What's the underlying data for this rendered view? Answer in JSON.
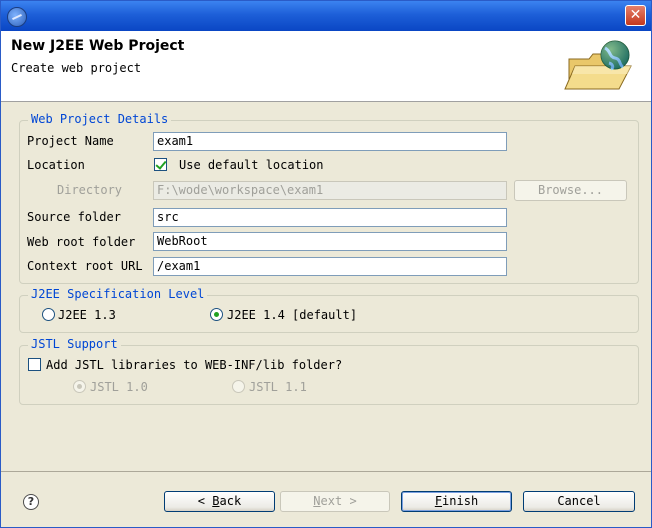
{
  "window": {
    "close_glyph": "✕"
  },
  "header": {
    "title": "New J2EE Web Project",
    "subtitle": "Create web project"
  },
  "web_details": {
    "group_title": "Web Project Details",
    "project_name_label": "Project Name",
    "project_name_value": "exam1",
    "location_label": "Location",
    "use_default_label": "Use default location",
    "use_default_checked": true,
    "directory_label": "Directory",
    "directory_value": "F:\\wode\\workspace\\exam1",
    "browse_label": "Browse...",
    "source_folder_label": "Source folder",
    "source_folder_value": "src",
    "web_root_label": "Web root folder",
    "web_root_value": "WebRoot",
    "context_root_label": "Context root URL",
    "context_root_value": "/exam1"
  },
  "spec_level": {
    "group_title": "J2EE Specification Level",
    "opt_13": "J2EE 1.3",
    "opt_14": "J2EE 1.4 [default]",
    "selected": "J2EE 1.4 [default]"
  },
  "jstl": {
    "group_title": "JSTL Support",
    "add_label": "Add JSTL libraries to WEB-INF/lib folder?",
    "add_checked": false,
    "opt_10": "JSTL 1.0",
    "opt_11": "JSTL 1.1",
    "selected": "JSTL 1.0"
  },
  "footer": {
    "help_glyph": "?",
    "back_arrow": "<",
    "back_letter": "B",
    "back_rest": "ack",
    "next_letter": "N",
    "next_rest": "ext",
    "next_arrow": ">",
    "finish_letter": "F",
    "finish_rest": "inish",
    "cancel_label": "Cancel"
  },
  "colors": {
    "accent": "#0046d5",
    "titlebar": "#0a46c4",
    "check": "#21a121"
  },
  "icons": {
    "app": "eclipse-icon",
    "header_art": "folder-globe-icon",
    "help": "help-icon"
  }
}
